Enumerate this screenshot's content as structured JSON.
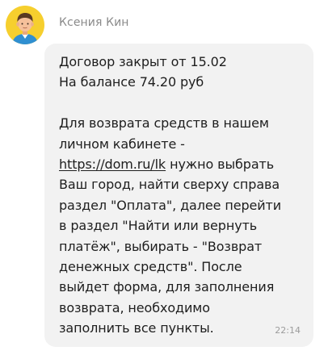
{
  "sender": {
    "name": "Ксения Кин",
    "avatar_icon": "person-avatar-icon",
    "avatar_bg": "#f6cf2e"
  },
  "message": {
    "text_before_link": "Договор закрыт от 15.02\nНа балансе 74.20 руб\n\nДля возврата средств в нашем\nличном кабинете -\n",
    "link_text": "https://dom.ru/lk",
    "text_after_link": " нужно выбрать\nВаш город, найти сверху справа\nраздел \"Оплата\", далее перейти\nв раздел \"Найти или вернуть\nплатёж\", выбирать - \"Возврат\nденежных средств\". После\nвыйдет форма, для заполнения\nвозврата, необходимо\nзаполнить все пункты.",
    "time": "22:14",
    "bubble_bg": "#f2f2f2"
  }
}
